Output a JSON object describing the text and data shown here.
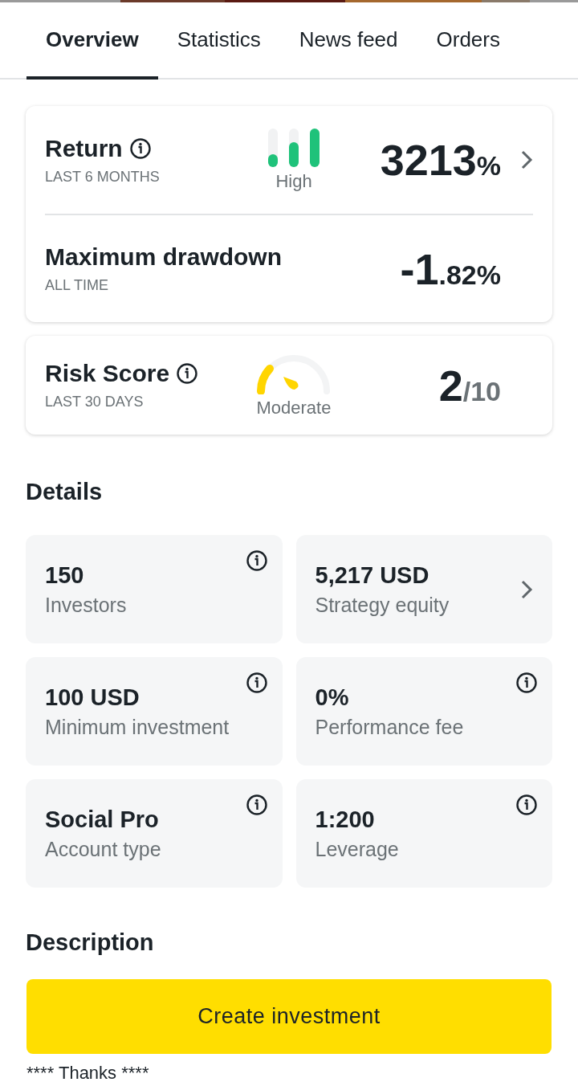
{
  "tabs": [
    {
      "label": "Overview",
      "selected": true
    },
    {
      "label": "Statistics",
      "selected": false
    },
    {
      "label": "News feed",
      "selected": false
    },
    {
      "label": "Orders",
      "selected": false
    }
  ],
  "performance_card": {
    "metrics": [
      {
        "title": "Return",
        "subtitle": "LAST 6 MONTHS",
        "indicator": {
          "kind": "bars",
          "label": "High"
        },
        "value_main": "3213",
        "value_suffix": "%",
        "chevron": true
      },
      {
        "title": "Maximum drawdown",
        "subtitle": "ALL TIME",
        "value_main": "-1",
        "value_suffix": ".82%",
        "chevron": false
      }
    ]
  },
  "risk_card": {
    "title": "Risk Score",
    "subtitle": "LAST 30 DAYS",
    "indicator": {
      "kind": "gauge",
      "label": "Moderate"
    },
    "value_main": "2",
    "value_suffix": "/10"
  },
  "details": {
    "heading": "Details",
    "items": [
      {
        "value": "150",
        "label": "Investors",
        "kind": "info"
      },
      {
        "value": "5,217 USD",
        "label": "Strategy equity",
        "kind": "link"
      },
      {
        "value": "100 USD",
        "label": "Minimum investment",
        "kind": "info"
      },
      {
        "value": "0%",
        "label": "Performance fee",
        "kind": "info"
      },
      {
        "value": "Social Pro",
        "label": "Account type",
        "kind": "info"
      },
      {
        "value": "1:200",
        "label": "Leverage",
        "kind": "info"
      }
    ]
  },
  "description": {
    "heading": "Description",
    "lines": [
      "**** Thanks ****"
    ]
  },
  "create_button": {
    "label": "Create investment"
  }
}
